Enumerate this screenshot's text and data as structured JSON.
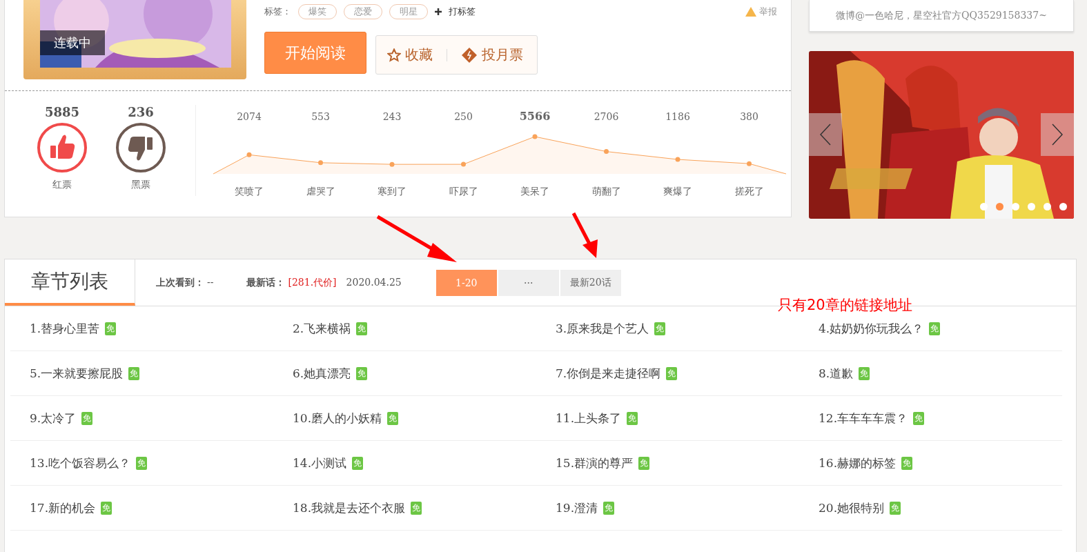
{
  "tags": {
    "label": "标签：",
    "items": [
      "爆笑",
      "恋爱",
      "明星"
    ],
    "add": "打标签",
    "report": "举报"
  },
  "cover": {
    "status": "连载中"
  },
  "actions": {
    "read": "开始阅读",
    "favorite": "收藏",
    "vote": "投月票"
  },
  "votes": [
    {
      "kind": "up",
      "count": "5885",
      "label": "红票"
    },
    {
      "kind": "down",
      "count": "236",
      "label": "黑票"
    }
  ],
  "reactions": {
    "chart_data": {
      "type": "area",
      "categories": [
        "笑喷了",
        "虐哭了",
        "寒到了",
        "吓尿了",
        "美呆了",
        "萌翻了",
        "爽爆了",
        "搓死了"
      ],
      "series": [
        {
          "color": "#f9a35a",
          "values": [
            2074,
            553,
            243,
            250,
            5566,
            2706,
            1186,
            380
          ]
        }
      ],
      "data_labels": true
    }
  },
  "notice": {
    "text": "微博@一色哈尼，星空社官方QQ3529158337~"
  },
  "banner": {
    "slides": [
      {
        "selected": false
      },
      {
        "selected": true
      },
      {
        "selected": false
      },
      {
        "selected": false
      },
      {
        "selected": false
      },
      {
        "selected": false
      }
    ]
  },
  "chapters": {
    "title": "章节列表",
    "last_read_label": "上次看到：",
    "last_read": "--",
    "latest_label": "最新话：",
    "latest": "[281.代价]",
    "date": "2020.04.25",
    "ranges": [
      {
        "label": "1-20",
        "selected": true
      },
      {
        "label": "···",
        "selected": false
      },
      {
        "label": "最新20话",
        "selected": false
      }
    ],
    "items": [
      {
        "title": "1.替身心里苦",
        "badge": "免"
      },
      {
        "title": "2.飞来横祸",
        "badge": "免"
      },
      {
        "title": "3.原来我是个艺人",
        "badge": "免"
      },
      {
        "title": "4.姑奶奶你玩我么？",
        "badge": "免"
      },
      {
        "title": "5.一来就要擦屁股",
        "badge": "免"
      },
      {
        "title": "6.她真漂亮",
        "badge": "免"
      },
      {
        "title": "7.你倒是来走捷径啊",
        "badge": "免"
      },
      {
        "title": "8.道歉",
        "badge": "免"
      },
      {
        "title": "9.太冷了",
        "badge": "免"
      },
      {
        "title": "10.磨人的小妖精",
        "badge": "免"
      },
      {
        "title": "11.上头条了",
        "badge": "免"
      },
      {
        "title": "12.车车车车震？",
        "badge": "免"
      },
      {
        "title": "13.吃个饭容易么？",
        "badge": "免"
      },
      {
        "title": "14.小测试",
        "badge": "免"
      },
      {
        "title": "15.群演的尊严",
        "badge": "免"
      },
      {
        "title": "16.赫娜的标签",
        "badge": "免"
      },
      {
        "title": "17.新的机会",
        "badge": "免"
      },
      {
        "title": "18.我就是去还个衣服",
        "badge": "免"
      },
      {
        "title": "19.澄清",
        "badge": "免"
      },
      {
        "title": "20.她很特别",
        "badge": "免"
      }
    ]
  },
  "annotation": {
    "text": "只有20章的链接地址"
  }
}
